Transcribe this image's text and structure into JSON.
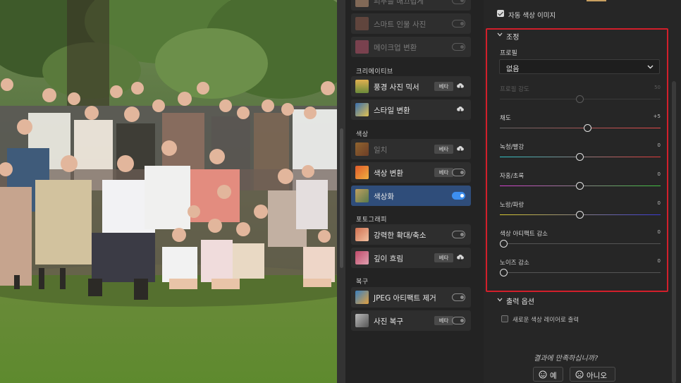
{
  "filter_list": {
    "top_items": [
      {
        "label": "피부를 매끄럽게",
        "state": "off",
        "dim": true
      },
      {
        "label": "스마트 인물 사진",
        "state": "off",
        "dim": true
      },
      {
        "label": "메이크업 변환",
        "state": "off",
        "dim": true
      }
    ],
    "sections": [
      {
        "title": "크리에이티브",
        "items": [
          {
            "label": "풍경 사진 믹서",
            "badge": "베타",
            "icon": "cloud-download-icon",
            "dim": false
          },
          {
            "label": "스타일 변환",
            "icon": "cloud-download-icon",
            "dim": false
          }
        ]
      },
      {
        "title": "색상",
        "items": [
          {
            "label": "일치",
            "badge": "베타",
            "icon": "cloud-download-icon",
            "dim": true
          },
          {
            "label": "색상 변환",
            "badge": "베타",
            "state": "off",
            "dim": false
          },
          {
            "label": "색상화",
            "state": "on",
            "active": true,
            "dim": false
          }
        ]
      },
      {
        "title": "포토그래피",
        "items": [
          {
            "label": "강력한 확대/축소",
            "state": "off",
            "dim": false
          },
          {
            "label": "깊이 흐림",
            "badge": "베타",
            "icon": "cloud-download-icon",
            "dim": false
          }
        ]
      },
      {
        "title": "복구",
        "items": [
          {
            "label": "JPEG 아티팩트 제거",
            "state": "off",
            "dim": false
          },
          {
            "label": "사진 복구",
            "badge": "베타",
            "state": "off",
            "dim": false
          }
        ]
      }
    ]
  },
  "settings": {
    "auto_color_label": "자동 색상 이미지",
    "auto_color_checked": true,
    "adjust_title": "조정",
    "profile_label": "프로필",
    "profile_value": "없음",
    "sliders": [
      {
        "label": "프로필 강도",
        "value_text": "50",
        "value": 50,
        "min": 0,
        "max": 100,
        "disabled": true
      },
      {
        "label": "채도",
        "value_text": "+5",
        "value": 5,
        "min": -50,
        "max": 50
      },
      {
        "label": "녹청/빨강",
        "value_text": "0",
        "value": 0,
        "min": -50,
        "max": 50
      },
      {
        "label": "자홍/초록",
        "value_text": "0",
        "value": 0,
        "min": -50,
        "max": 50
      },
      {
        "label": "노랑/파랑",
        "value_text": "0",
        "value": 0,
        "min": -50,
        "max": 50
      },
      {
        "label": "색상 아티팩트 감소",
        "value_text": "0",
        "value": 0,
        "min": 0,
        "max": 100
      },
      {
        "label": "노이즈 감소",
        "value_text": "0",
        "value": 0,
        "min": 0,
        "max": 100
      }
    ],
    "output_title": "출력 옵션",
    "output_new_layer_label": "새로운 색상 레이어로 출력",
    "output_new_layer_checked": false,
    "feedback_question": "결과에 만족하십니까?",
    "yes_label": "예",
    "no_label": "아니오"
  },
  "colors": {
    "accent": "#3d8ff0",
    "active_item": "#2f4d7a",
    "highlight_box": "#d21f2b"
  }
}
